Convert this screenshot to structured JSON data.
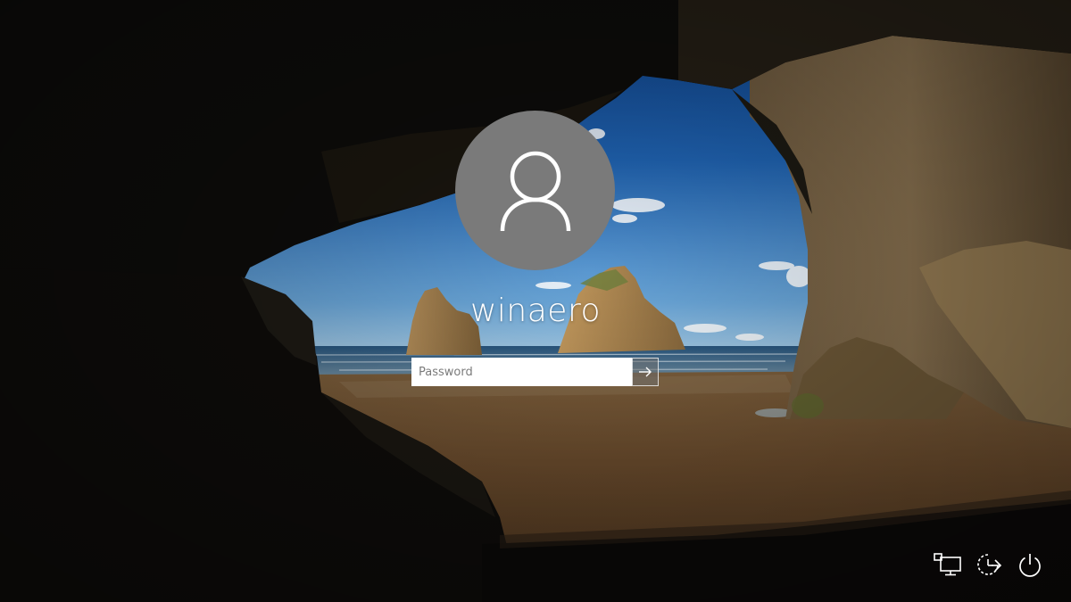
{
  "user": {
    "name": "winaero"
  },
  "password_field": {
    "placeholder": "Password",
    "value": ""
  },
  "icons": {
    "avatar": "user-avatar-icon",
    "submit": "arrow-right-icon",
    "network": "network-icon",
    "ease_of_access": "ease-of-access-icon",
    "power": "power-icon"
  },
  "colors": {
    "avatar_bg": "#7a7a7a",
    "text": "#ffffff"
  }
}
